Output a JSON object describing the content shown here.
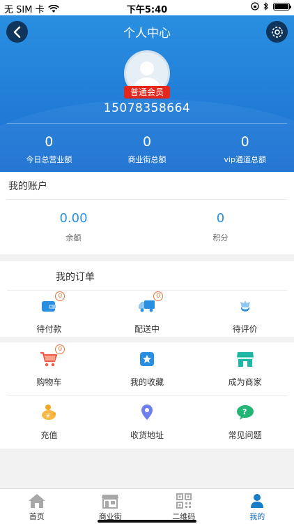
{
  "status_bar": {
    "carrier": "无 SIM 卡",
    "time": "下午5:40"
  },
  "header": {
    "title": "个人中心",
    "member_badge": "普通会员",
    "phone": "15078358664",
    "stats": [
      {
        "value": "0",
        "label": "今日总营业额"
      },
      {
        "value": "0",
        "label": "商业街总额"
      },
      {
        "value": "0",
        "label": "vip通道总额"
      }
    ]
  },
  "account": {
    "title": "我的账户",
    "items": [
      {
        "value": "0.00",
        "label": "余额"
      },
      {
        "value": "0",
        "label": "积分"
      }
    ]
  },
  "orders": {
    "title": "我的订单",
    "items": [
      {
        "label": "待付款",
        "icon": "wallet-icon",
        "count": "0"
      },
      {
        "label": "配送中",
        "icon": "delivery-truck-icon",
        "count": "0"
      },
      {
        "label": "待评价",
        "icon": "review-icon"
      }
    ]
  },
  "services": {
    "items": [
      {
        "label": "购物车",
        "icon": "shopping-cart-icon",
        "count": "0"
      },
      {
        "label": "我的收藏",
        "icon": "favorites-icon"
      },
      {
        "label": "成为商家",
        "icon": "store-icon"
      },
      {
        "label": "充值",
        "icon": "piggy-bank-icon"
      },
      {
        "label": "收货地址",
        "icon": "location-pin-icon"
      },
      {
        "label": "常见问题",
        "icon": "faq-icon"
      }
    ]
  },
  "tabbar": {
    "items": [
      {
        "label": "首页",
        "icon": "home-icon"
      },
      {
        "label": "商业街",
        "icon": "shop-street-icon"
      },
      {
        "label": "二维码",
        "icon": "qr-code-icon"
      },
      {
        "label": "我的",
        "icon": "user-icon",
        "active": true
      }
    ]
  },
  "colors": {
    "header_blue": "#1a6fd1",
    "accent_blue": "#2a8fe0",
    "badge_red": "#e5261b",
    "count_orange": "#e8743b"
  }
}
